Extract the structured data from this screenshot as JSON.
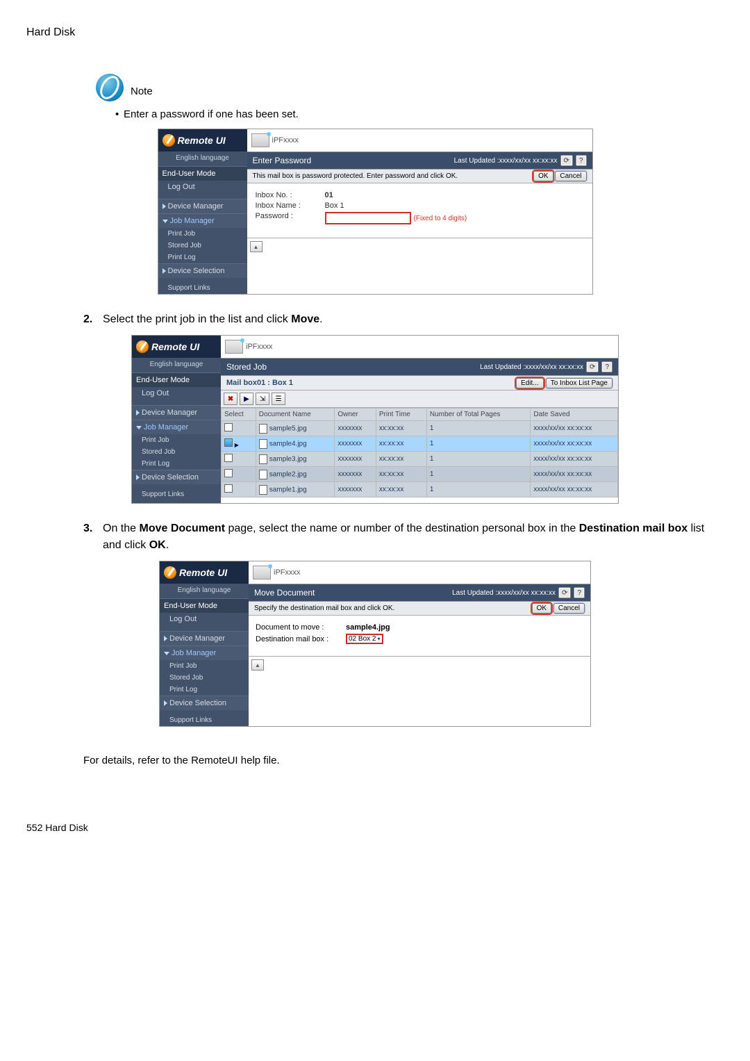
{
  "section_header": "Hard Disk",
  "note": {
    "label": "Note",
    "bullet": "Enter a password if one has been set."
  },
  "common": {
    "remote_title": "Remote UI",
    "printer_model": "iPFxxxx",
    "english": "English language",
    "mode": "End-User Mode",
    "logout": "Log Out",
    "last_updated": "Last Updated :xxxx/xx/xx xx:xx:xx",
    "refresh_glyph": "⟳",
    "help_glyph": "?",
    "ok": "OK",
    "cancel": "Cancel",
    "edit": "Edit...",
    "scroll_up": "▲"
  },
  "sidebar": {
    "device_manager": "Device Manager",
    "job_manager": "Job Manager",
    "print_job": "Print Job",
    "stored_job": "Stored Job",
    "print_log": "Print Log",
    "device_selection": "Device Selection",
    "support_links": "Support Links"
  },
  "shot1": {
    "panel_title": "Enter Password",
    "warning": "This mail box is password protected. Enter password and click OK.",
    "inbox_no_label": "Inbox No. :",
    "inbox_no_value": "01",
    "inbox_name_label": "Inbox Name :",
    "inbox_name_value": "Box 1",
    "password_label": "Password :",
    "fixed_note": "(Fixed to 4 digits)"
  },
  "step2_prefix": "Select the print job in the list and click ",
  "step2_bold": "Move",
  "step2_suffix": ".",
  "shot2": {
    "panel_title": "Stored Job",
    "mailbox": "Mail box01 : Box 1",
    "to_inbox_list": "To Inbox List Page",
    "cols": {
      "select": "Select",
      "doc": "Document Name",
      "owner": "Owner",
      "ptime": "Print Time",
      "pages": "Number of Total Pages",
      "saved": "Date Saved"
    },
    "rows": [
      {
        "doc": "sample5.jpg",
        "owner": "xxxxxxx",
        "ptime": "xx:xx:xx",
        "pages": "1",
        "saved": "xxxx/xx/xx xx:xx:xx",
        "sel": false,
        "hl": false
      },
      {
        "doc": "sample4.jpg",
        "owner": "xxxxxxx",
        "ptime": "xx:xx:xx",
        "pages": "1",
        "saved": "xxxx/xx/xx xx:xx:xx",
        "sel": true,
        "hl": true
      },
      {
        "doc": "sample3.jpg",
        "owner": "xxxxxxx",
        "ptime": "xx:xx:xx",
        "pages": "1",
        "saved": "xxxx/xx/xx xx:xx:xx",
        "sel": false,
        "hl": false
      },
      {
        "doc": "sample2.jpg",
        "owner": "xxxxxxx",
        "ptime": "xx:xx:xx",
        "pages": "1",
        "saved": "xxxx/xx/xx xx:xx:xx",
        "sel": false,
        "hl": false
      },
      {
        "doc": "sample1.jpg",
        "owner": "xxxxxxx",
        "ptime": "xx:xx:xx",
        "pages": "1",
        "saved": "xxxx/xx/xx xx:xx:xx",
        "sel": false,
        "hl": false
      }
    ]
  },
  "step3_a": "On the ",
  "step3_b": "Move Document",
  "step3_c": " page, select the name or number of the destination personal box in the ",
  "step3_d": "Destination mail box",
  "step3_e": " list and click ",
  "step3_f": "OK",
  "step3_g": ".",
  "shot3": {
    "panel_title": "Move Document",
    "instruction": "Specify the destination mail box and click OK.",
    "doc_move_label": "Document to move :",
    "doc_move_value": "sample4.jpg",
    "dest_label": "Destination mail box :",
    "dest_value": "02 Box 2",
    "dest_arrow": "▾"
  },
  "footer_line": "For details, refer to the RemoteUI help file.",
  "page_number": "552  Hard Disk"
}
